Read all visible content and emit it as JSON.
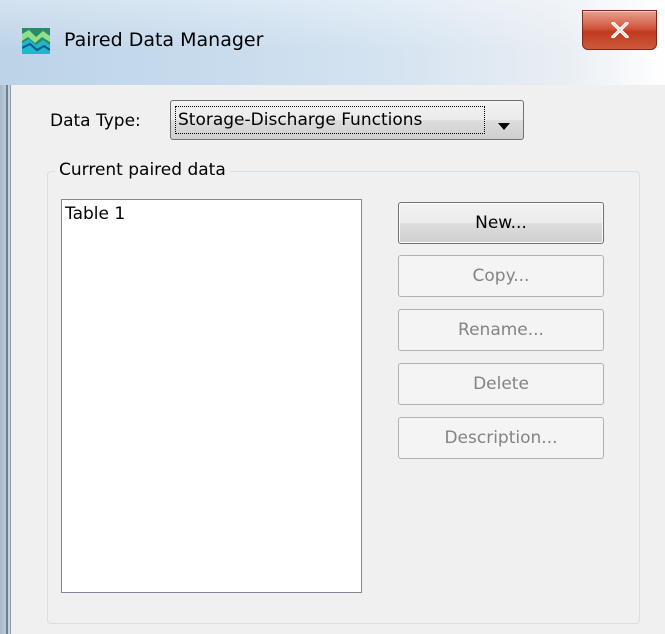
{
  "window": {
    "title": "Paired Data Manager",
    "close_label": "X"
  },
  "form": {
    "data_type_label": "Data Type:",
    "data_type_value": "Storage-Discharge Functions",
    "group_label": "Current paired data"
  },
  "list": {
    "items": [
      "Table 1"
    ]
  },
  "buttons": {
    "new": {
      "label": "New...",
      "enabled": true
    },
    "copy": {
      "label": "Copy...",
      "enabled": false
    },
    "rename": {
      "label": "Rename...",
      "enabled": false
    },
    "delete": {
      "label": "Delete",
      "enabled": false
    },
    "description": {
      "label": "Description...",
      "enabled": false
    }
  },
  "icons": {
    "app": "paired-data-icon",
    "close": "close-icon",
    "dropdown": "chevron-down-icon"
  },
  "colors": {
    "close_button": "#c1391f",
    "disabled_text": "#838383"
  }
}
